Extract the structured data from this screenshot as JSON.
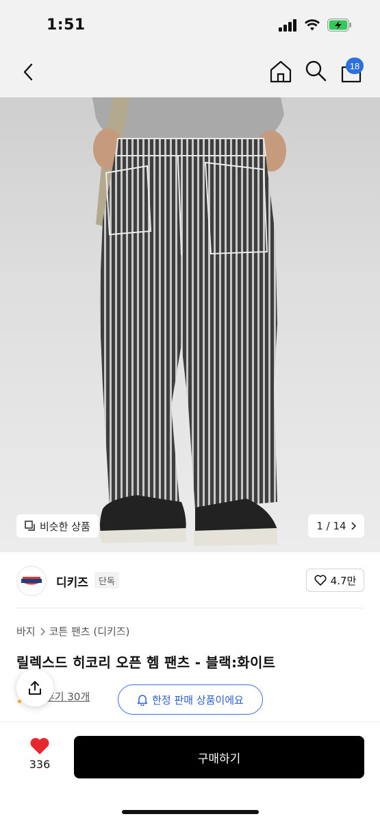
{
  "status_bar": {
    "time": "1:51"
  },
  "nav": {
    "back_icon": "chevron-left-icon",
    "home_icon": "home-icon",
    "search_icon": "search-icon",
    "bag_icon": "shopping-bag-icon",
    "bag_badge": "18",
    "badge_color": "#2e6fe0"
  },
  "image": {
    "similar_label": "비슷한 상품",
    "pager": "1 / 14"
  },
  "brand": {
    "logo_text": "Dickies",
    "name": "디키즈",
    "tag": "단독",
    "likes": "4.7만"
  },
  "product": {
    "breadcrumb": [
      "바지",
      "코튼 팬츠 (디키즈)"
    ],
    "title": "릴렉스드 히코리 오픈 헴 팬츠 - 블랙:화이트",
    "review_link": "후기 30개",
    "limited_label": "한정 판매 상품이에요",
    "accent_color": "#2a5fcf"
  },
  "bottom": {
    "like_count": "336",
    "buy_label": "구매하기",
    "heart_color": "#e8262d"
  }
}
